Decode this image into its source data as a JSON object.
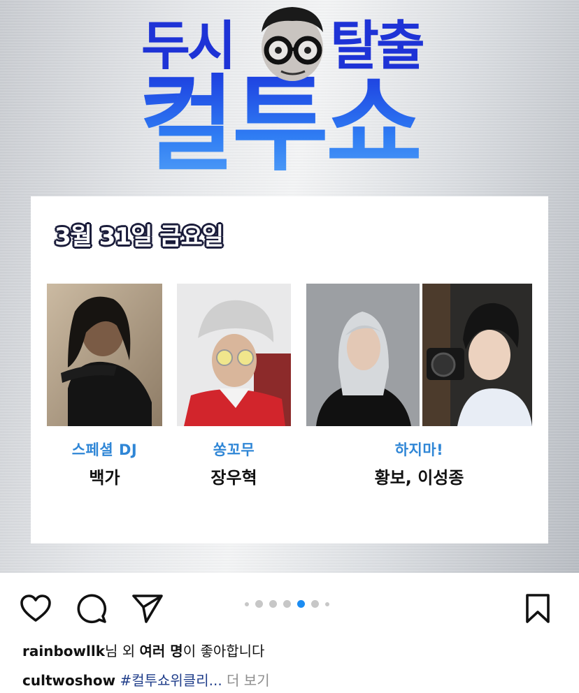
{
  "post": {
    "logo": {
      "top_left": "두시",
      "top_right": "탈출",
      "main": "컬투쇼"
    },
    "card": {
      "date": "3월 31일 금요일",
      "guests": [
        {
          "role": "스페셜 DJ",
          "name": "백가"
        },
        {
          "role": "쏭꼬무",
          "name": "장우혁"
        },
        {
          "role": "하지마!",
          "name": "황보, 이성종"
        }
      ]
    }
  },
  "carousel": {
    "total_dots": 7,
    "active_index": 4
  },
  "icons": {
    "like": "heart-icon",
    "comment": "comment-bubble-icon",
    "share": "paper-plane-icon",
    "save": "bookmark-icon"
  },
  "likes": {
    "user": "rainbowllk",
    "suffix_1": "님 외 ",
    "others": "여러 명",
    "suffix_2": "이 좋아합니다"
  },
  "caption": {
    "user": "cultwoshow",
    "hashtag": "#컬투쇼위클리...",
    "more": "더 보기"
  },
  "colors": {
    "accent_blue": "#1b8cf2",
    "logo_blue": "#2a49e0",
    "role_blue": "#2f86d6",
    "hashtag": "#1f3d8a"
  }
}
